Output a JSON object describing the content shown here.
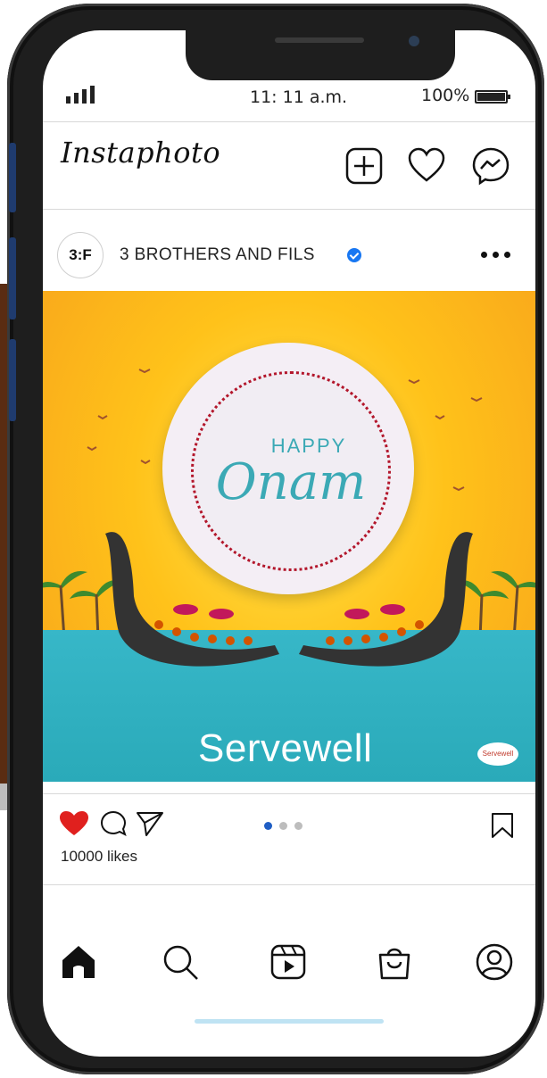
{
  "status_bar": {
    "time": "11: 11 a.m.",
    "battery": "100%"
  },
  "header": {
    "app_name": "Instaphoto"
  },
  "post": {
    "username": "3 BROTHERS AND FILS",
    "avatar_text": "3:F",
    "image": {
      "greeting_small": "HAPPY",
      "greeting_large": "Onam",
      "brand": "Servewell",
      "mini_logo": "Servewell"
    },
    "likes": "10000 likes",
    "carousel": {
      "pages": 3,
      "active": 1
    }
  },
  "colors": {
    "like_red": "#e0201e",
    "accent_blue": "#1f5ec4",
    "teal": "#3ba9b5"
  },
  "icons": [
    "signal-icon",
    "battery-icon",
    "new-post-icon",
    "heart-icon",
    "messenger-icon",
    "verified-icon",
    "more-icon",
    "like-icon",
    "comment-icon",
    "share-icon",
    "bookmark-icon",
    "home-icon",
    "search-icon",
    "reels-icon",
    "shop-icon",
    "profile-icon"
  ]
}
